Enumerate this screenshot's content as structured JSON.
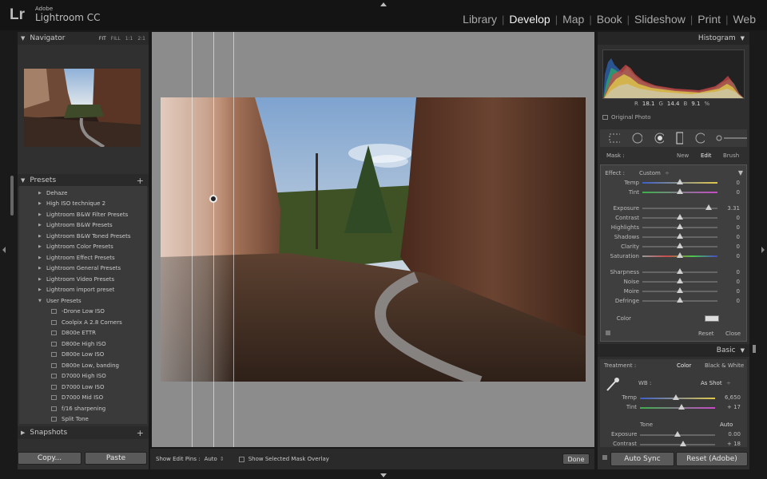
{
  "app": {
    "adobe": "Adobe",
    "product": "Lightroom CC",
    "lr": "Lr"
  },
  "modules": [
    "Library",
    "Develop",
    "Map",
    "Book",
    "Slideshow",
    "Print",
    "Web"
  ],
  "left": {
    "navigator": {
      "title": "Navigator",
      "zoom": [
        "FIT",
        "FILL",
        "1:1",
        "2:1"
      ]
    },
    "presets": {
      "title": "Presets",
      "folders": [
        "Dehaze",
        "High ISO technique 2",
        "Lightroom B&W Filter Presets",
        "Lightroom B&W Presets",
        "Lightroom B&W Toned Presets",
        "Lightroom Color Presets",
        "Lightroom Effect Presets",
        "Lightroom General Presets",
        "Lightroom Video Presets",
        "Lightroom import preset",
        "User Presets"
      ],
      "user_presets": [
        "-Drone Low ISO",
        "Coolpix A 2.8 Corners",
        "D800e ETTR",
        "D800e High ISO",
        "D800e Low ISO",
        "D800e Low, banding",
        "D7000 High ISO",
        "D7000 Low ISO",
        "D7000 Mid ISO",
        "f/16 sharpening",
        "Split Tone"
      ]
    },
    "snapshots": {
      "title": "Snapshots"
    },
    "copy": "Copy...",
    "paste": "Paste"
  },
  "toolbar": {
    "show_pins_label": "Show Edit Pins :",
    "show_pins_value": "Auto",
    "overlay_label": "Show Selected Mask Overlay",
    "done": "Done"
  },
  "right": {
    "histogram": {
      "title": "Histogram",
      "r_label": "R",
      "r": "18.1",
      "g_label": "G",
      "g": "14.4",
      "b_label": "B",
      "b": "9.1",
      "pct": "%",
      "original": "Original Photo"
    },
    "mask": {
      "label": "Mask :",
      "new": "New",
      "edit": "Edit",
      "brush": "Brush"
    },
    "effect": {
      "label": "Effect :",
      "value": "Custom"
    },
    "sliders": [
      {
        "label": "Temp",
        "value": "0",
        "pos": 0.5,
        "track": "temp"
      },
      {
        "label": "Tint",
        "value": "0",
        "pos": 0.5,
        "track": "tint"
      },
      {
        "label": "Exposure",
        "value": "3.31",
        "pos": 0.88,
        "track": "plain"
      },
      {
        "label": "Contrast",
        "value": "0",
        "pos": 0.5,
        "track": "plain"
      },
      {
        "label": "Highlights",
        "value": "0",
        "pos": 0.5,
        "track": "plain"
      },
      {
        "label": "Shadows",
        "value": "0",
        "pos": 0.5,
        "track": "plain"
      },
      {
        "label": "Clarity",
        "value": "0",
        "pos": 0.5,
        "track": "plain"
      },
      {
        "label": "Saturation",
        "value": "0",
        "pos": 0.5,
        "track": "sat"
      },
      {
        "label": "Sharpness",
        "value": "0",
        "pos": 0.5,
        "track": "plain"
      },
      {
        "label": "Noise",
        "value": "0",
        "pos": 0.5,
        "track": "plain"
      },
      {
        "label": "Moire",
        "value": "0",
        "pos": 0.5,
        "track": "plain"
      },
      {
        "label": "Defringe",
        "value": "0",
        "pos": 0.5,
        "track": "plain"
      }
    ],
    "color_label": "Color",
    "reset": "Reset",
    "close": "Close",
    "basic": {
      "title": "Basic",
      "treatment_label": "Treatment :",
      "color": "Color",
      "bw": "Black & White",
      "wb_label": "WB :",
      "wb_value": "As Shot",
      "temp_label": "Temp",
      "temp_value": "6,650",
      "tint_label": "Tint",
      "tint_value": "+ 17",
      "tone_label": "Tone",
      "auto": "Auto",
      "exposure_label": "Exposure",
      "exposure_value": "0.00",
      "contrast_label": "Contrast",
      "contrast_value": "+ 18"
    },
    "auto_sync": "Auto Sync",
    "reset_adobe": "Reset (Adobe)"
  }
}
